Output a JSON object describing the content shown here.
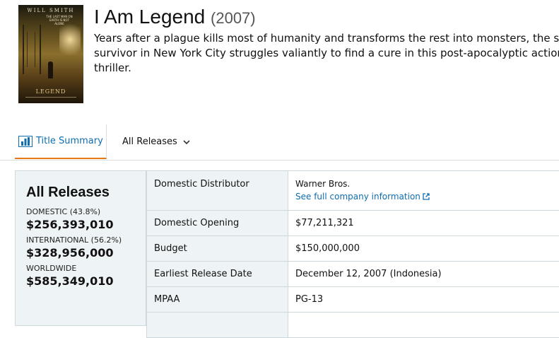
{
  "movie": {
    "title": "I Am Legend",
    "year": "(2007)",
    "description": "Years after a plague kills most of humanity and transforms the rest into monsters, the sole survivor in New York City struggles valiantly to find a cure in this post-apocalyptic action thriller.",
    "poster": {
      "actor": "WILL SMITH",
      "tagline": "THE LAST MAN ON EARTH IS NOT ALONE",
      "logo_text": "LEGEND"
    }
  },
  "tabs": {
    "summary": {
      "label": "Title Summary",
      "icon": "bar-chart-icon",
      "active": true
    },
    "releases": {
      "label": "All Releases",
      "icon": "chevron-down-icon"
    }
  },
  "summary_box": {
    "heading": "All Releases",
    "domestic_label": "DOMESTIC (43.8%)",
    "domestic_value": "$256,393,010",
    "international_label": "INTERNATIONAL (56.2%)",
    "international_value": "$328,956,000",
    "worldwide_label": "WORLDWIDE",
    "worldwide_value": "$585,349,010"
  },
  "details": {
    "distributor_label": "Domestic Distributor",
    "distributor_value": "Warner Bros.",
    "distributor_link": "See full company information",
    "opening_label": "Domestic Opening",
    "opening_value": "$77,211,321",
    "budget_label": "Budget",
    "budget_value": "$150,000,000",
    "release_label": "Earliest Release Date",
    "release_value": "December 12, 2007 (Indonesia)",
    "mpaa_label": "MPAA",
    "mpaa_value": "PG-13"
  },
  "colors": {
    "accent": "#e47911",
    "link": "#0f6db0",
    "panel": "#eef4f6",
    "border": "#cfd8dc"
  }
}
